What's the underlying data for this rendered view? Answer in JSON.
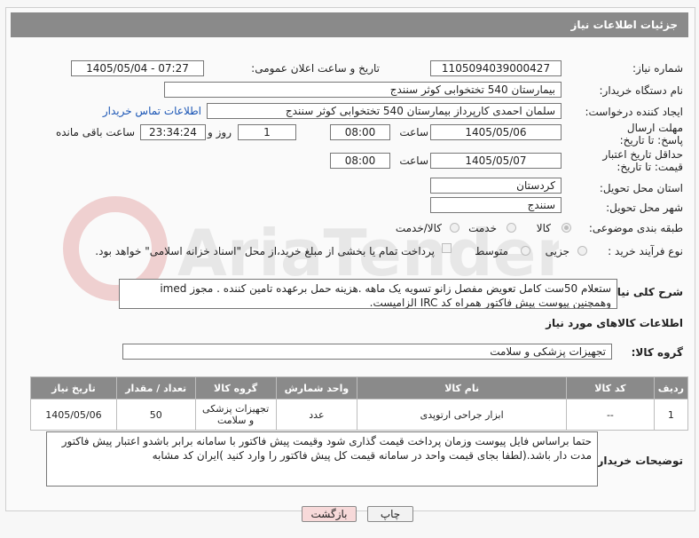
{
  "header": {
    "title": "جزئیات اطلاعات نیاز"
  },
  "labels": {
    "need_number": "شماره نیاز:",
    "announce_datetime": "تاریخ و ساعت اعلان عمومی:",
    "buyer_org": "نام دستگاه خریدار:",
    "requester": "ایجاد کننده درخواست:",
    "reply_deadline": "مهلت ارسال پاسخ: تا تاریخ:",
    "time": "ساعت",
    "day": "روز و",
    "remaining": "ساعت باقی مانده",
    "min_price_validity": "حداقل تاریخ اعتبار قیمت: تا تاریخ:",
    "delivery_province": "استان محل تحویل:",
    "delivery_city": "شهر محل تحویل:",
    "category": "طبقه بندی موضوعی:",
    "purchase_type": "نوع فرآیند خرید :",
    "description": "شرح کلی نیاز:",
    "goods_info": "اطلاعات کالاهای مورد نیاز",
    "goods_group": "گروه کالا:",
    "buyer_notes": "توضیحات خریدار:"
  },
  "fields": {
    "need_number": "1105094039000427",
    "announce_datetime": "1405/05/04 - 07:27",
    "buyer_org": "بیمارستان 540 تختخوابی کوثر سنندج",
    "requester": "سلمان احمدی کارپرداز بیمارستان 540 تختخوابی کوثر سنندج",
    "contact_link": "اطلاعات تماس خریدار",
    "reply_date": "1405/05/06",
    "reply_time": "08:00",
    "remaining_days": "1",
    "remaining_time": "23:34:24",
    "validity_date": "1405/05/07",
    "validity_time": "08:00",
    "province": "کردستان",
    "city": "سنندج",
    "goods_group": "تجهیزات پزشکی و سلامت"
  },
  "category_options": [
    "کالا",
    "خدمت",
    "کالا/خدمت"
  ],
  "category_selected": "کالا",
  "purchase_options": [
    "جزیی",
    "متوسط"
  ],
  "payment_note": "پرداخت تمام یا بخشی از مبلغ خرید،از محل \"اسناد خزانه اسلامی\" خواهد بود.",
  "description_text": "ستعلام 50ست کامل تعویض مفصل زانو تسویه یک ماهه .هزینه حمل برعهده تامین کننده . مجوز imed وهمچنین پیوست پیش فاکتور همراه کد IRC الزامیست.",
  "table": {
    "headers": [
      "ردیف",
      "کد کالا",
      "نام کالا",
      "واحد شمارش",
      "گروه کالا",
      "تعداد / مقدار",
      "تاریخ نیاز"
    ],
    "rows": [
      [
        "1",
        "--",
        "ابزار جراحی ارتوپدی",
        "عدد",
        "تجهیزات پزشکی و سلامت",
        "50",
        "1405/05/06"
      ]
    ]
  },
  "buyer_notes_text": "حتما براساس فایل پیوست وزمان پرداخت قیمت گذاری شود وقیمت پیش فاکتور با سامانه برابر باشدو اعتبار پیش فاکتور مدت دار باشد.(لطفا بجای قیمت واحد در سامانه قیمت کل پیش فاکتور را وارد کنید )ایران کد مشابه",
  "buttons": {
    "print": "چاپ",
    "back": "بازگشت"
  },
  "colors": {
    "header_bg": "#8a8a8a",
    "back_button_bg": "#f7d9d9",
    "link": "#1a55b5"
  }
}
